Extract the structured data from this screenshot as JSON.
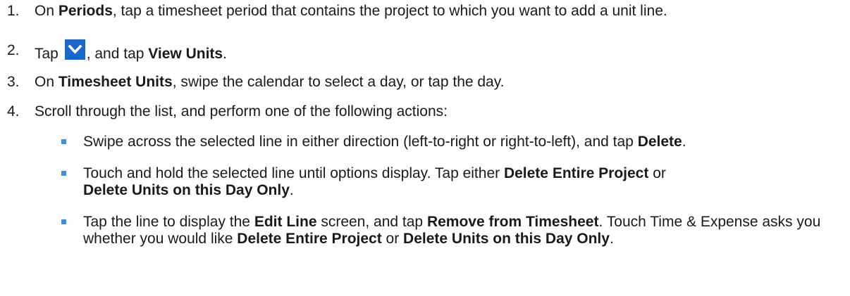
{
  "steps": [
    {
      "number": "1.",
      "parts": [
        "On ",
        "Periods",
        ", tap a timesheet period that contains the project to which you want to add a unit line."
      ]
    },
    {
      "number": "2.",
      "parts": [
        "Tap ",
        ", and tap ",
        "View Units",
        "."
      ],
      "icon": "chevron-down-icon"
    },
    {
      "number": "3.",
      "parts": [
        "On ",
        "Timesheet Units",
        ", swipe the calendar to select a day, or tap the day."
      ]
    },
    {
      "number": "4.",
      "parts": [
        "Scroll through the list, and perform one of the following actions:"
      ]
    }
  ],
  "bullets": [
    {
      "parts": [
        "Swipe across the selected line in either direction (left-to-right or right-to-left), and tap ",
        "Delete",
        "."
      ]
    },
    {
      "parts": [
        "Touch and hold the selected line until options display. Tap either ",
        "Delete Entire Project",
        " or ",
        "Delete Units on this Day Only",
        "."
      ]
    },
    {
      "parts": [
        "Tap the line to display the ",
        "Edit Line",
        " screen, and tap ",
        "Remove from Timesheet",
        ". Touch Time & Expense asks you whether you would like ",
        "Delete Entire Project",
        " or ",
        "Delete Units on this Day Only",
        "."
      ]
    }
  ],
  "colors": {
    "icon_background": "#1b66c9",
    "bullet_square": "#3d8fe0",
    "text": "#1a1a1a"
  }
}
